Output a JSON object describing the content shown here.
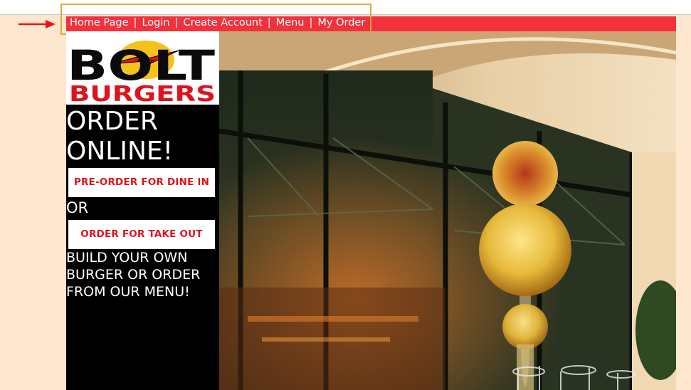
{
  "nav": {
    "items": [
      {
        "label": "Home Page"
      },
      {
        "label": "Login"
      },
      {
        "label": "Create Account"
      },
      {
        "label": "Menu"
      },
      {
        "label": "My Order"
      }
    ],
    "separator": "|"
  },
  "logo": {
    "line1": "BOLT",
    "line2": "BURGERS"
  },
  "sidebar": {
    "heading_line1": "ORDER",
    "heading_line2": "ONLINE!",
    "dine_in_button": "PRE-ORDER FOR DINE IN",
    "or_text": "OR",
    "take_out_button": "ORDER FOR TAKE OUT",
    "build_line1": "BUILD YOUR OWN",
    "build_line2": "BURGER OR ORDER",
    "build_line3": "FROM OUR MENU!"
  },
  "colors": {
    "navbar": "#f2313c",
    "page_background": "#fde7ce",
    "highlight_box": "#f0a23a",
    "arrow": "#e8131c",
    "cta_text": "#e0121c"
  }
}
